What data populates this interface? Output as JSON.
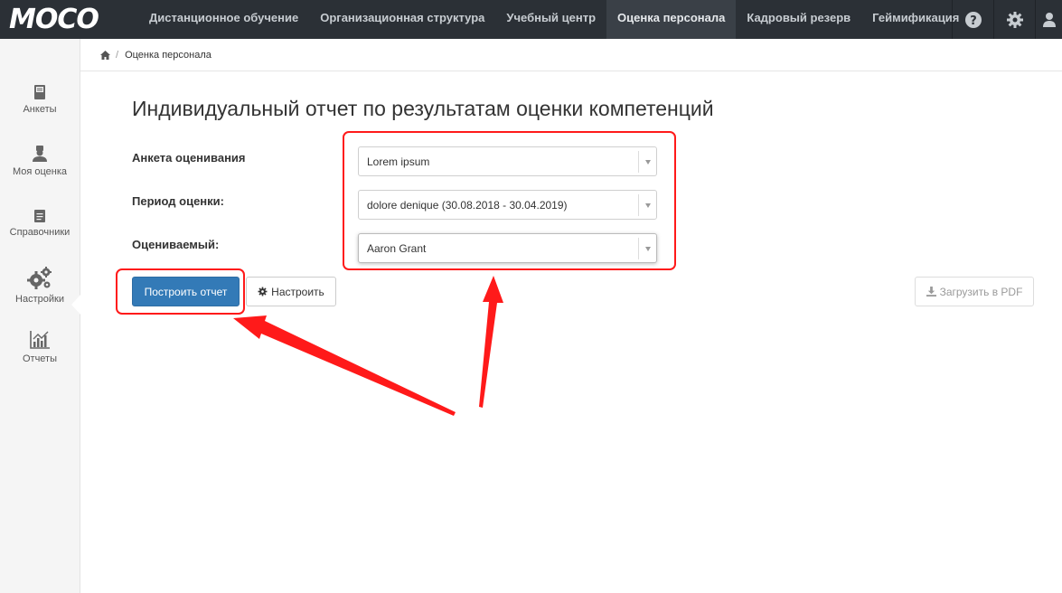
{
  "app": {
    "logo_text": "MOCO"
  },
  "nav": {
    "items": [
      {
        "label": "Дистанционное обучение",
        "active": false
      },
      {
        "label": "Организационная структура",
        "active": false
      },
      {
        "label": "Учебный центр",
        "active": false
      },
      {
        "label": "Оценка персонала",
        "active": true
      },
      {
        "label": "Кадровый резерв",
        "active": false
      },
      {
        "label": "Геймификация",
        "active": false
      }
    ],
    "icons": [
      "help-icon",
      "gear-icon",
      "user-icon"
    ]
  },
  "sidebar": {
    "items": [
      {
        "label": "Анкеты",
        "icon": "book-icon"
      },
      {
        "label": "Моя оценка",
        "icon": "user-badge-icon"
      },
      {
        "label": "Справочники",
        "icon": "document-icon"
      },
      {
        "label": "Настройки",
        "icon": "gears-icon"
      },
      {
        "label": "Отчеты",
        "icon": "chart-icon",
        "active": true
      }
    ]
  },
  "breadcrumb": {
    "current": "Оценка персонала",
    "separator": "/"
  },
  "main": {
    "title": "Индивидуальный отчет по результатам оценки компетенций",
    "form": {
      "questionnaire_label": "Анкета оценивания",
      "questionnaire_value": "Lorem ipsum",
      "period_label": "Период оценки:",
      "period_value": "dolore denique (30.08.2018 - 30.04.2019)",
      "evaluee_label": "Оцениваемый:",
      "evaluee_value": "Aaron Grant"
    },
    "buttons": {
      "build": "Построить отчет",
      "configure": "Настроить",
      "pdf": "Загрузить в PDF"
    }
  },
  "colors": {
    "navbar": "#2b3036",
    "primary": "#337ab7",
    "annotation": "#ff1a1a"
  }
}
